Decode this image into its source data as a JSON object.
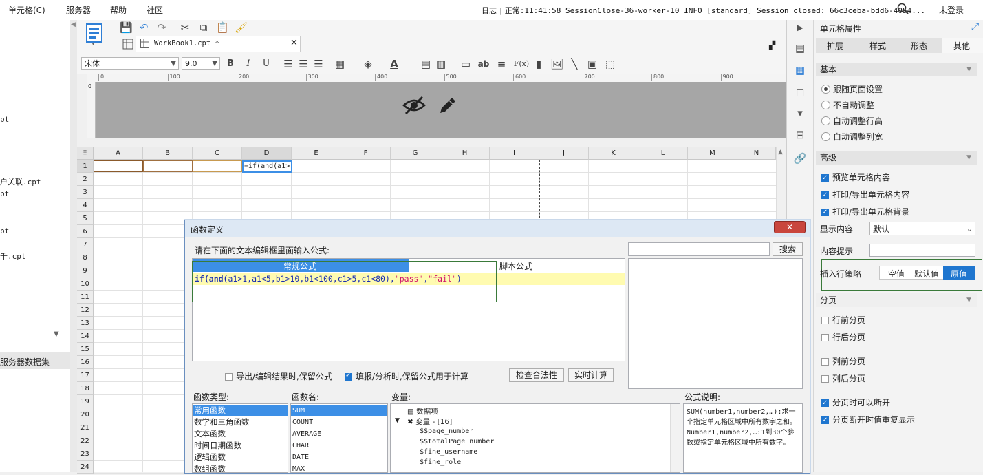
{
  "menubar": {
    "items": [
      "单元格(C)",
      "服务器",
      "帮助",
      "社区"
    ],
    "log_label": "日志",
    "status_text": "正常:11:41:58 SessionClose-36-worker-10 INFO [standard] Session closed: 66c3ceba-bdd6-4054...",
    "login_label": "未登录"
  },
  "left_panel": {
    "items": [
      "pt",
      "户关联.cpt",
      "pt",
      "pt",
      "千.cpt"
    ],
    "server_dataset_label": "服务器数据集"
  },
  "toolbar": {
    "tab_title": "WorkBook1.cpt *",
    "font_name": "宋体",
    "font_size": "9.0",
    "bold": "B",
    "italic": "I",
    "underline": "U",
    "ab_label": "ab",
    "fx_label": "F(x)"
  },
  "ruler": {
    "labels": [
      "0",
      "100",
      "200",
      "300",
      "400",
      "500",
      "600",
      "700",
      "800",
      "900"
    ]
  },
  "grid": {
    "columns": [
      "A",
      "B",
      "C",
      "D",
      "E",
      "F",
      "G",
      "H",
      "I",
      "J",
      "K",
      "L",
      "M",
      "N"
    ],
    "rows": [
      "1",
      "2",
      "3",
      "4",
      "5",
      "6",
      "7",
      "8",
      "9",
      "10",
      "11",
      "12",
      "13",
      "14",
      "15",
      "16",
      "17",
      "18",
      "19",
      "20",
      "21",
      "22",
      "23",
      "24"
    ],
    "d1_value": "=if(and(a1>"
  },
  "right_panel": {
    "title": "单元格属性",
    "tabs": [
      "扩展",
      "样式",
      "形态",
      "其他"
    ],
    "active_tab": "其他",
    "basic": {
      "header": "基本",
      "options": [
        "跟随页面设置",
        "不自动调整",
        "自动调整行高",
        "自动调整列宽"
      ],
      "selected": "跟随页面设置"
    },
    "advanced": {
      "header": "高级",
      "checks": [
        "预览单元格内容",
        "打印/导出单元格内容",
        "打印/导出单元格背景"
      ],
      "display_label": "显示内容",
      "display_value": "默认",
      "hint_label": "内容提示",
      "insert_label": "插入行策略",
      "insert_options": [
        "空值",
        "默认值",
        "原值"
      ],
      "insert_selected": "原值"
    },
    "paging": {
      "header": "分页",
      "options": [
        "行前分页",
        "行后分页",
        "列前分页",
        "列后分页"
      ],
      "checked_options": [
        "分页时可以断开",
        "分页断开时值重复显示"
      ]
    }
  },
  "dialog": {
    "title": "函数定义",
    "prompt": "请在下面的文本编辑框里面输入公式:",
    "tab_normal": "常规公式",
    "tab_script": "脚本公式",
    "formula": {
      "if": "if(",
      "and": "and(",
      "args": "a1>1,a1<5,b1>10,b1<100,c1>5,c1<80),",
      "pass": "\"pass\"",
      "comma": ",",
      "fail": "\"fail\"",
      "close": ")"
    },
    "search_button": "搜索",
    "keep_formula_export": "导出/编辑结果时,保留公式",
    "keep_formula_fill": "填报/分析时,保留公式用于计算",
    "check_button": "检查合法性",
    "realtime_button": "实时计算",
    "func_type_label": "函数类型:",
    "func_types": [
      "常用函数",
      "数学和三角函数",
      "文本函数",
      "时间日期函数",
      "逻辑函数",
      "数组函数"
    ],
    "func_name_label": "函数名:",
    "func_names": [
      "SUM",
      "COUNT",
      "AVERAGE",
      "CHAR",
      "DATE",
      "MAX"
    ],
    "var_label": "变量:",
    "var_tree": {
      "data_items": "数据项",
      "vars": "变量 - [16]",
      "children": [
        "$$page_number",
        "$$totalPage_number",
        "$fine_username",
        "$fine_role"
      ]
    },
    "desc_label": "公式说明:",
    "desc_text": "SUM(number1,number2,…):求一个指定单元格区域中所有数字之和。 Number1,number2,…:1到30个参数或指定单元格区域中所有数字。"
  },
  "colors": {
    "accent_blue": "#3c8fe6",
    "formula_highlight": "#fffbb0",
    "selection_green": "#3a7a3a"
  }
}
